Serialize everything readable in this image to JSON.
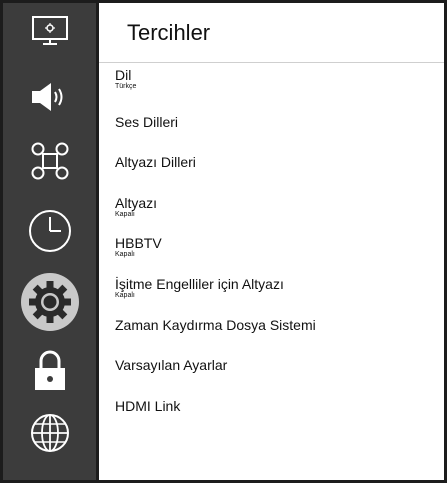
{
  "page": {
    "title": "Tercihler"
  },
  "sidebar": {
    "items": [
      {
        "icon": "monitor-icon"
      },
      {
        "icon": "speaker-icon"
      },
      {
        "icon": "command-icon"
      },
      {
        "icon": "clock-icon"
      },
      {
        "icon": "gear-icon",
        "selected": true
      },
      {
        "icon": "lock-icon"
      },
      {
        "icon": "globe-icon"
      }
    ]
  },
  "menu": {
    "items": [
      {
        "label": "Dil",
        "value": "Türkçe"
      },
      {
        "label": "Ses Dilleri"
      },
      {
        "label": "Altyazı Dilleri"
      },
      {
        "label": "Altyazı",
        "value": "Kapalı"
      },
      {
        "label": "HBBTV",
        "value": "Kapalı"
      },
      {
        "label": "İşitme Engelliler için Altyazı",
        "value": "Kapalı"
      },
      {
        "label": "Zaman Kaydırma Dosya Sistemi"
      },
      {
        "label": "Varsayılan Ayarlar"
      },
      {
        "label": "HDMI Link"
      }
    ]
  },
  "colors": {
    "sidebar_bg": "#3c3c3c",
    "icon": "#ffffff",
    "selected_bg": "#c9c9c9",
    "border": "#1c1c1c"
  }
}
